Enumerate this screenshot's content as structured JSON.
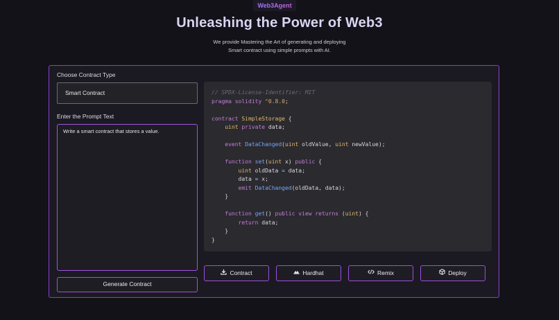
{
  "header": {
    "brand": "Web3Agent",
    "title": "Unleashing the Power of Web3",
    "subtitle_line1": "We provide Mastering the Art of generating and deploying",
    "subtitle_line2": "Smart contract using simple prompts with AI."
  },
  "form": {
    "contract_type_label": "Choose Contract Type",
    "contract_type_value": "Smart Contract",
    "prompt_label": "Enter the Prompt Text",
    "prompt_value": "Write a smart contract that stores a value.",
    "generate_label": "Generate Contract"
  },
  "code_lines": [
    "// SPDX-License-Identifier: MIT",
    "pragma solidity ^0.8.0;",
    "",
    "contract SimpleStorage {",
    "    uint private data;",
    "",
    "    event DataChanged(uint oldValue, uint newValue);",
    "",
    "    function set(uint x) public {",
    "        uint oldData = data;",
    "        data = x;",
    "        emit DataChanged(oldData, data);",
    "    }",
    "",
    "    function get() public view returns (uint) {",
    "        return data;",
    "    }",
    "}"
  ],
  "actions": {
    "contract": {
      "label": "Contract",
      "icon": "download-icon"
    },
    "hardhat": {
      "label": "Hardhat",
      "icon": "hardhat-icon"
    },
    "remix": {
      "label": "Remix",
      "icon": "code-icon"
    },
    "deploy": {
      "label": "Deploy",
      "icon": "cube-icon"
    }
  },
  "colors": {
    "accent": "#a64fdc",
    "background": "#141219",
    "panel": "#1b1a22",
    "code_bg": "#2a2a2f"
  }
}
